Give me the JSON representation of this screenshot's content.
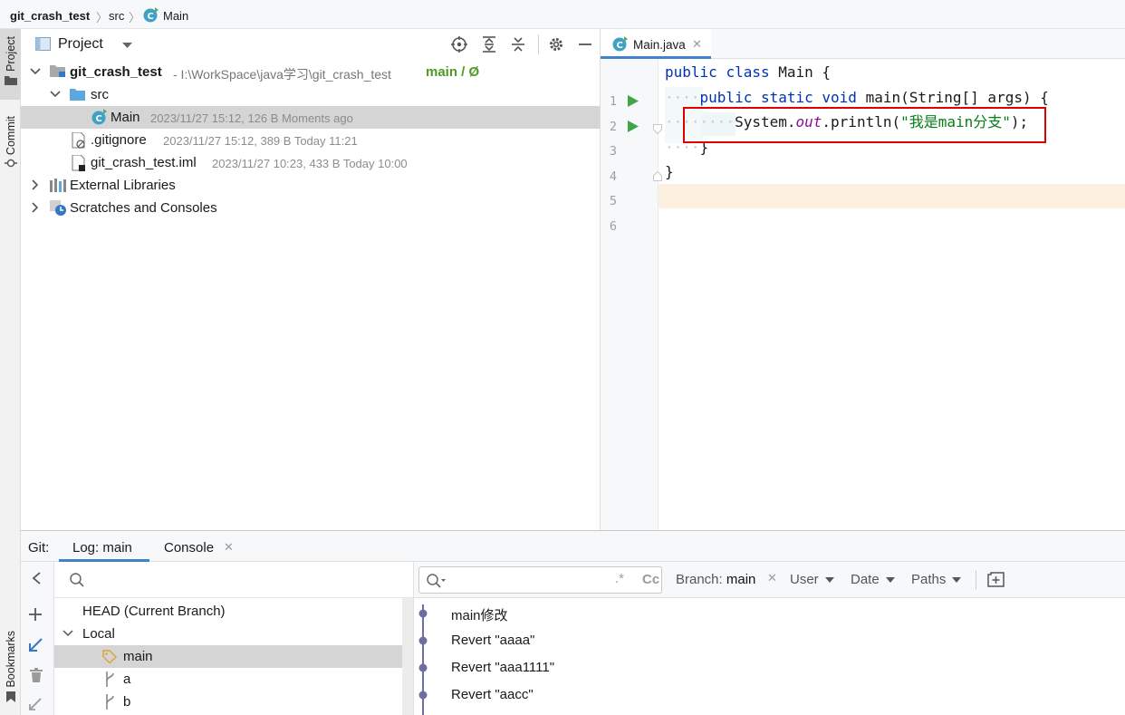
{
  "breadcrumb": {
    "project": "git_crash_test",
    "folder": "src",
    "file": "Main"
  },
  "side_tabs": {
    "project": "Project",
    "commit": "Commit",
    "bookmarks": "Bookmarks"
  },
  "project_panel": {
    "title": "Project",
    "tree": {
      "root": {
        "name": "git_crash_test",
        "path": "- I:\\WorkSpace\\java学习\\git_crash_test",
        "branch": "main / Ø"
      },
      "src": {
        "name": "src"
      },
      "main": {
        "name": "Main",
        "meta": "2023/11/27 15:12, 126 B Moments ago"
      },
      "gitignore": {
        "name": ".gitignore",
        "meta": "2023/11/27 15:12, 389 B Today 11:21"
      },
      "iml": {
        "name": "git_crash_test.iml",
        "meta": "2023/11/27 10:23, 433 B Today 10:00"
      },
      "external": {
        "name": "External Libraries"
      },
      "scratches": {
        "name": "Scratches and Consoles"
      }
    }
  },
  "editor": {
    "tab_label": "Main.java",
    "line_numbers": [
      "1",
      "2",
      "3",
      "4",
      "5",
      "6"
    ],
    "code": {
      "l1_kw1": "public",
      "l1_kw2": "class",
      "l1_rest": " Main {",
      "l2_kw1": "public",
      "l2_kw2": "static",
      "l2_kw3": "void",
      "l2_rest": " main(String[] args) {",
      "l3_a": "System.",
      "l3_field": "out",
      "l3_b": ".println(",
      "l3_str": "\"我是main分支\"",
      "l3_c": ");",
      "l4": "}",
      "l5": "}"
    },
    "highlight_color": "#e00000",
    "current_line_color": "#fcf0e0"
  },
  "bottom": {
    "git_label": "Git:",
    "tab_log": "Log: main",
    "tab_console": "Console",
    "branches": {
      "head": "HEAD (Current Branch)",
      "local": "Local",
      "items": [
        "main",
        "a",
        "b"
      ]
    },
    "filters": {
      "branch_prefix": "Branch: ",
      "branch_value": "main",
      "user": "User",
      "date": "Date",
      "paths": "Paths"
    },
    "commits": [
      "main修改",
      "Revert \"aaaa\"",
      "Revert \"aaa1111\"",
      "Revert \"aacc\""
    ],
    "graph_color": "#6e6ea3"
  }
}
